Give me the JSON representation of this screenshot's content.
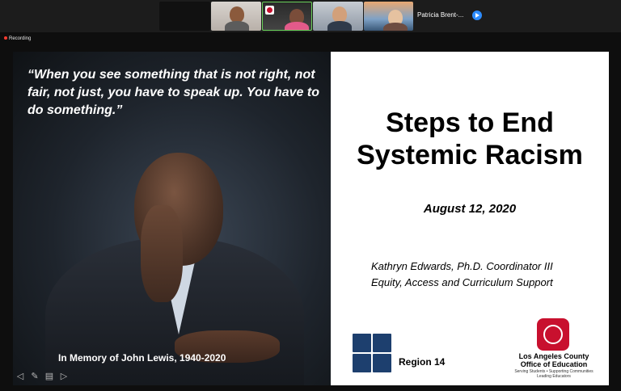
{
  "participants": [
    {
      "name": ""
    },
    {
      "name": ""
    },
    {
      "name": ""
    },
    {
      "name": ""
    },
    {
      "name": ""
    },
    {
      "name": "Patricia Brent-..."
    }
  ],
  "recording_label": "Recording",
  "slide": {
    "quote": "“When you see something that is not right, not fair, not just, you have to speak up. You have to do something.”",
    "caption": "In Memory of John Lewis, 1940-2020",
    "title_line1": "Steps to End",
    "title_line2": "Systemic Racism",
    "date": "August 12, 2020",
    "presenter_line1": "Kathryn Edwards, Ph.D. Coordinator III",
    "presenter_line2": "Equity, Access and Curriculum Support",
    "region_label": "Region 14",
    "org_line1": "Los Angeles County",
    "org_line2": "Office of Education",
    "org_tagline1": "Serving Students • Supporting Communities",
    "org_tagline2": "Leading Educators"
  },
  "colors": {
    "accent": "#2d8cff",
    "recording": "#ff3b30",
    "org_red": "#c8102e",
    "region_blue": "#1d3f6e"
  }
}
